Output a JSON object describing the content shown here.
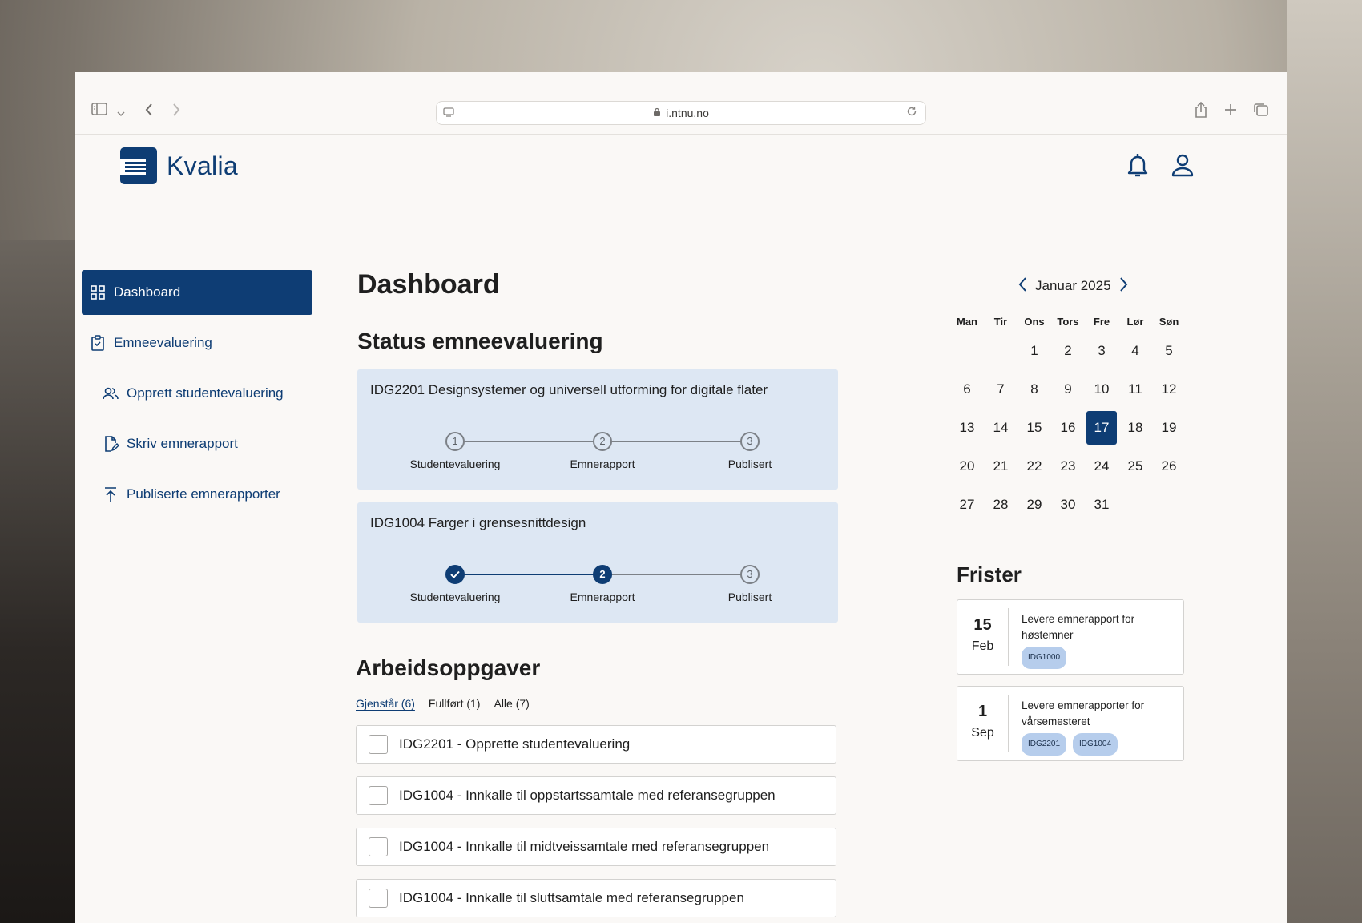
{
  "browser": {
    "url": "i.ntnu.no"
  },
  "app": {
    "name": "Kvalia"
  },
  "sidebar": {
    "items": [
      {
        "label": "Dashboard"
      },
      {
        "label": "Emneevaluering"
      },
      {
        "label": "Opprett studentevaluering"
      },
      {
        "label": "Skriv emnerapport"
      },
      {
        "label": "Publiserte emnerapporter"
      }
    ]
  },
  "main": {
    "title": "Dashboard",
    "status_title": "Status emneevaluering",
    "courses": [
      {
        "title": "IDG2201 Designsystemer og universell utforming for digitale flater",
        "completed_steps": 0,
        "current_step": 0
      },
      {
        "title": "IDG1004 Farger i grensesnittdesign",
        "completed_steps": 1,
        "current_step": 2
      }
    ],
    "steps": [
      {
        "num": "1",
        "label": "Studentevaluering"
      },
      {
        "num": "2",
        "label": "Emnerapport"
      },
      {
        "num": "3",
        "label": "Publisert"
      }
    ],
    "tasks_title": "Arbeidsoppgaver",
    "tabs": [
      "Gjenstår (6)",
      "Fullført (1)",
      "Alle (7)"
    ],
    "tasks": [
      "IDG2201 - Opprette studentevaluering",
      "IDG1004 - Innkalle til oppstartssamtale med referansegruppen",
      "IDG1004 - Innkalle til midtveissamtale med referansegruppen",
      "IDG1004 - Innkalle til sluttsamtale med referansegruppen"
    ]
  },
  "calendar": {
    "month": "Januar 2025",
    "weekdays": [
      "Man",
      "Tir",
      "Ons",
      "Tors",
      "Fre",
      "Lør",
      "Søn"
    ],
    "weeks": [
      [
        "",
        "",
        "1",
        "2",
        "3",
        "4",
        "5"
      ],
      [
        "6",
        "7",
        "8",
        "9",
        "10",
        "11",
        "12"
      ],
      [
        "13",
        "14",
        "15",
        "16",
        "17",
        "18",
        "19"
      ],
      [
        "20",
        "21",
        "22",
        "23",
        "24",
        "25",
        "26"
      ],
      [
        "27",
        "28",
        "29",
        "30",
        "31",
        "",
        ""
      ]
    ],
    "today": "17"
  },
  "deadlines": {
    "title": "Frister",
    "items": [
      {
        "day": "15",
        "month": "Feb",
        "text": "Levere emnerapport for høstemner",
        "chips": [
          "IDG1000"
        ]
      },
      {
        "day": "1",
        "month": "Sep",
        "text": "Levere emnerapporter for vårsemesteret",
        "chips": [
          "IDG2201",
          "IDG1004"
        ]
      }
    ]
  },
  "colors": {
    "primary": "#0e3d74",
    "card_bg": "#dde7f3",
    "chip_bg": "#b6cdec",
    "page_bg": "#faf8f6"
  }
}
